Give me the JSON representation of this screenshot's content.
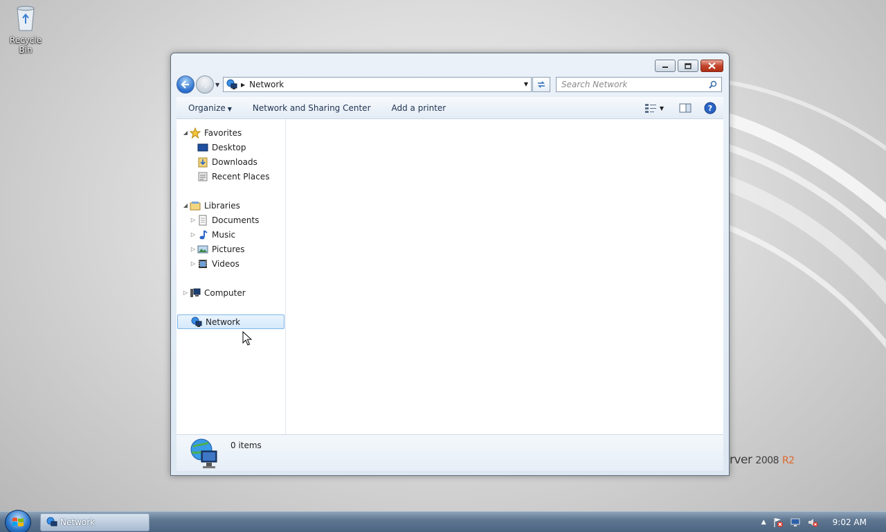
{
  "desktop": {
    "recycle_bin_label": "Recycle Bin",
    "branding": {
      "text": "rver",
      "version": "2008",
      "edition": "R2"
    }
  },
  "window": {
    "address": {
      "breadcrumb": "Network"
    },
    "search": {
      "placeholder": "Search Network"
    },
    "toolbar": {
      "organize": "Organize",
      "network_sharing": "Network and Sharing Center",
      "add_printer": "Add a printer"
    },
    "nav_pane": {
      "favorites": {
        "label": "Favorites",
        "items": [
          "Desktop",
          "Downloads",
          "Recent Places"
        ]
      },
      "libraries": {
        "label": "Libraries",
        "items": [
          "Documents",
          "Music",
          "Pictures",
          "Videos"
        ]
      },
      "computer": "Computer",
      "network": "Network"
    },
    "details": {
      "item_count": "0 items"
    }
  },
  "taskbar": {
    "task_label": "Network",
    "clock": "9:02 AM"
  },
  "colors": {
    "accent": "#2a6ccc",
    "selection": "#d5e9fb",
    "close_button": "#c3452d",
    "taskbar": "#5f7791"
  },
  "icons": [
    "back-arrow-icon",
    "forward-arrow-icon",
    "network-icon",
    "refresh-icon",
    "search-icon",
    "change-view-icon",
    "preview-pane-icon",
    "help-icon",
    "star-icon",
    "desktop-icon",
    "downloads-icon",
    "recent-places-icon",
    "library-icon",
    "documents-icon",
    "music-icon",
    "pictures-icon",
    "videos-icon",
    "computer-icon",
    "windows-logo-icon",
    "flag-icon",
    "display-icon",
    "speaker-muted-icon"
  ]
}
